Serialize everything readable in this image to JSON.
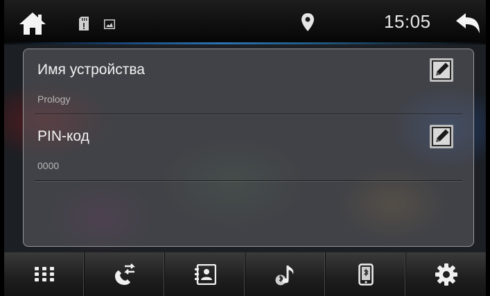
{
  "status_bar": {
    "time": "15:05",
    "icons": [
      "home-icon",
      "sd-card-icon",
      "image-icon",
      "location-pin-icon",
      "back-arrow-icon"
    ]
  },
  "settings": {
    "items": [
      {
        "title": "Имя устройства",
        "value": "Prology",
        "action_icon": "edit-icon"
      },
      {
        "title": "PIN-код",
        "value": "0000",
        "action_icon": "edit-icon"
      }
    ]
  },
  "bottom_nav": {
    "items": [
      {
        "icon": "dialpad-icon"
      },
      {
        "icon": "call-history-icon"
      },
      {
        "icon": "contacts-icon"
      },
      {
        "icon": "bluetooth-music-icon"
      },
      {
        "icon": "bluetooth-phone-icon"
      },
      {
        "icon": "settings-gear-icon"
      }
    ]
  },
  "colors": {
    "accent_blue": "#2f7fc7",
    "panel_border": "#dcdcdc",
    "text_primary": "#f2f2f2",
    "text_secondary": "#b8b8b8"
  }
}
